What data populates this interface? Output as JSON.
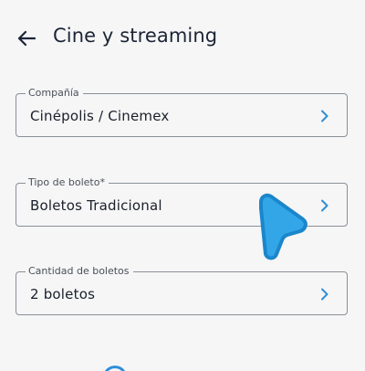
{
  "header": {
    "title": "Cine y streaming",
    "back_icon": "arrow-left-icon"
  },
  "form": {
    "fields": [
      {
        "label": "Compañía",
        "value": "Cinépolis / Cinemex",
        "icon": "chevron-right-icon"
      },
      {
        "label": "Tipo de boleto*",
        "value": "Boletos Tradicional",
        "icon": "chevron-right-icon"
      },
      {
        "label": "Cantidad de boletos",
        "value": "2 boletos",
        "icon": "chevron-right-icon"
      }
    ]
  },
  "colors": {
    "background": "#f6f6f6",
    "accent": "#2f8fd8",
    "cursor_fill": "#33a6e8",
    "cursor_border": "#1a86cc",
    "border": "#8a8f98"
  }
}
